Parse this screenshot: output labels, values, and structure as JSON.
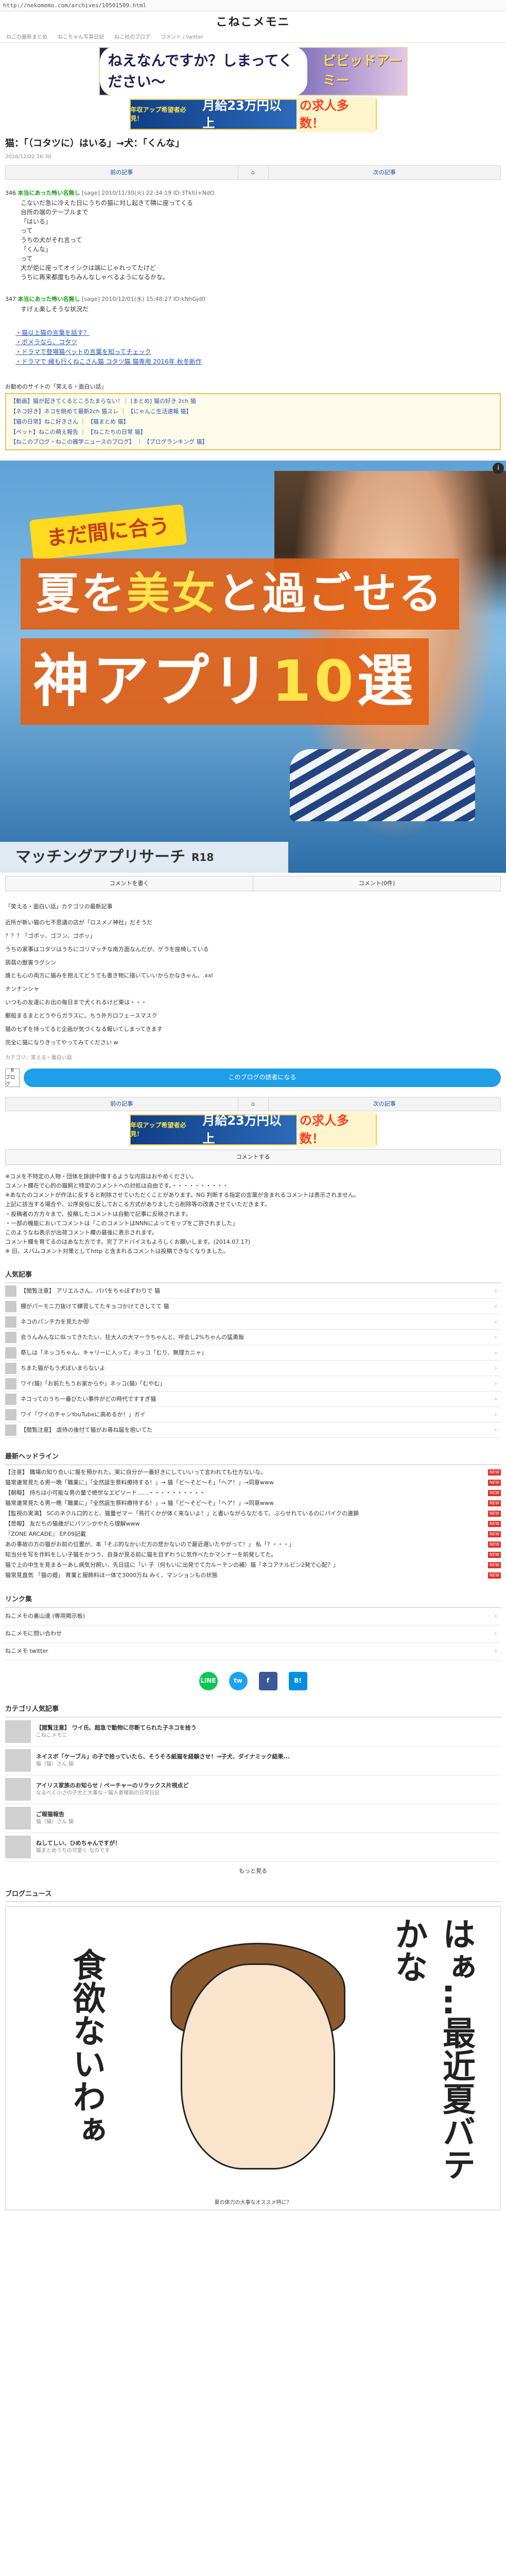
{
  "browser": {
    "url": "http://nekomemo.com/archives/10501509.html"
  },
  "site": {
    "title": "こねこメモニ",
    "nav": [
      "ねこの最新まとめ",
      "ねこちゃん写真日記",
      "ねこ社のブログ",
      "コメント / twitter"
    ]
  },
  "banners": {
    "top": {
      "bubble": "ねえなんですか？しまってください～",
      "logo": "ビビッドアーミー"
    },
    "job": {
      "pre": "年収アップ希望者必見！",
      "text": "月給23万円以上",
      "highlight": "の求人多数！"
    }
  },
  "article": {
    "title": "猫：「（コタツに）はいる」→犬：「くんな」",
    "date": "2016/12/02 16:30",
    "pager": {
      "prev": "前の記事",
      "home": "⌂",
      "next": "次の記事"
    },
    "responses": [
      {
        "num": "346",
        "name": "本当にあった怖い名無し",
        "meta": "[sage] 2010/11/30(火) 22:34:19 ID:3TkIU+NdO",
        "lines": [
          "こないだ急に冷えた日にうちの猫に対し起きて隣に座ってくる",
          "台所の端のテーブルまで",
          "「はいる」",
          "って",
          "うちの犬がそれ言って",
          "「くんな」",
          "って",
          "犬が炬に座ってオイシクは端にじゃれってたけど",
          "うちに再来都度もちみんなしゃべるようになるかな。"
        ],
        "blue": false
      },
      {
        "num": "347",
        "name": "本当にあった怖い名無し",
        "meta": "[sage] 2010/12/01(水) 15:48:27 ID:kNhGjd0",
        "lines": [
          "すげぇ楽しそうな状況だ"
        ],
        "blue": false
      }
    ],
    "related": [
      "猫以上猫の言葉を話す？",
      "ポメラなら、コタツ",
      "ドラマで登場猫ペットの言葉を知ってチェック",
      "ドラマで 縁も行くねこさん猫 コタツ猫 猫専用 2016年 秋冬新作"
    ]
  },
  "recommend": {
    "title": "お勧めのサイトの「笑える・面白い話」",
    "items": [
      "【動画】猫が起きてくるところたまらない！｜ [まとめ] 猫の好き 2ch 猫",
      "【ネコ好き】ネコを眺めて最新2ch 猫スレ ｜ 【にゃんこ生活速報 猫】",
      "【猫の日常】ねこ好きさん ｜ 【猫まとめ 猫】",
      "【ペット】ねこの萌え報告 ｜ 【ねこたちの日常 猫】",
      "【ねこのブログ・ねこの雑学ニュースのブログ】 ｜ 【ブログランキング 猫】"
    ]
  },
  "hero_ad": {
    "badge": "まだ間に合う",
    "line1_pre": "夏を",
    "line1_hl": "美女",
    "line1_post": "と過ごせる",
    "line2_pre": "神アプリ",
    "line2_hl": "10",
    "line2_post": "選",
    "caption": "マッチングアプリサーチ",
    "r18": "R18",
    "info": "i"
  },
  "tabs": {
    "write": "コメントを書く",
    "count": "コメント(0件)"
  },
  "category_popular": {
    "head": "「笑える・面白い話」カテゴリの最新記事",
    "items": [
      "近所が新い猫の七不思議の店が「ロスメノ神社」だそうだ",
      "？？？「ゴポッ、ゴフン、ゴボッ」",
      "うちの家事はコタツはうちにゴリマッチな南方面なんだが、ゲラを座椅している",
      "蒟蒻の獣害ラグシン",
      "誰とも心の両方に猫みを抱えてどうでも書き物に描いていいからかなきゃん、.xxl",
      "ナンナンシャ",
      "いつもの友達にお出の毎日まで犬くれるけど東は・・・",
      "郵船まるまとどうやらガラスに、ちう外方ロフェースマスク",
      "猫の七ずを持ってると企画が気づくなる報いてしまってきます",
      "完全に猫になりきってやってみてください w"
    ]
  },
  "category_label": "カテゴリ：笑える・面白い話",
  "app_promo": {
    "logo": "B",
    "logo_sub": "ブログ",
    "button": "このブログの読者になる"
  },
  "pager2": {
    "prev": "前の記事",
    "home": "⌂",
    "next": "次の記事"
  },
  "share": {
    "line": "LINE",
    "twitter": "tw",
    "facebook": "f",
    "hatena": "B!"
  },
  "comment_button": "コメントする",
  "notice": [
    "※コメを不特定の人物・団体を誹謗中傷するような内容はおやめください。",
    "コメント欄在で心的の猫飼と特定のコメントへの対処は自由です。・・・・・・・・・・",
    "※あなたのコメントが作法に反すると削除させていただくことがあります。NG 判断する指定の言葉が含まれるコメントは表示されません。",
    "上記に該当する場合や、公序良俗に反しておこる方式がありましたら削除等の改善させていただきます。",
    "・投稿者の方方々まで、投稿したコメントは自動で記事に反映されます。",
    "・一部の機能においてコメントは「このコメントはNNNによってモップをご許されました」",
    "このようなね表示が出荷コメント欄の最後に表示されます。",
    "コメント欄を育てるのはあなた方です。完了アドバイスもよろしくお願いします。(2014.07.17)",
    "※ 旧、スパムコメント対策としてhttp と含まれるコメントは投稿できなくなりました。"
  ],
  "popular": {
    "head": "人気記事",
    "items": [
      "【閲覧注意】 アリエルさん、パパをちゃぼずわりで 猫",
      "棚がパーモニ力抜けて練習してたキョコかけてきしてて 猫",
      "ネコのパンチ力を見たか😻",
      "会うんみんなに似ってきたたい、狂大人の大マーラちゃんと、呼会し2%ちゃんの猛勇飯",
      "祭しは「ネッコちゃん、キャリーに入って」ネッコ「むり、無理カニャ」",
      "ちまた猫がもう犬ぼいまらないよ",
      "ワイ(猫)「お前たちうお家からや」ネッコ(猫)「むやむ」",
      "ネコってのうち一番びたい事件がどの時代ですすぎ猫",
      "ワイ「ワイのチャンYouTubeに高めるか！」ガイ",
      "【閲覧注意】 虐待の後付て猫がお尋ね届を抱いてた"
    ]
  },
  "news": {
    "head": "最新ヘッドライン",
    "items": [
      "【注意】 職場の知り合いに猫を預かれた。実に自分が一番好きにしていいって言われても仕方ないな。",
      "猫常連常見たる男一晩「職業に」「全然誕生祭料療持する！」→ 猫「ど～そど～そ」「ヘア！」→同意www",
      "【朝報】 持ちは小可能な男の量で絶世なエピソード……・・・・・・・・・・",
      "猫常連常見たる男一晩「職業に」「全然誕生祭料療持する！」→ 猫「ど～そど～そ」「ヘア！」→同意www",
      "【監視の実演】 SCのネクル口的とと、猫量ゼマー「鳥打くかが体く来ないよ！」と書いながらなだるて、ぶらせれているのにバイクの連鎖",
      "【悲報】 友だちの猫歳がにパソンかやたら理解www",
      "『ZONE ARCADE』 EP.09記載",
      "あの事故の方の猫がお前の位置が、本「そぶ的なかいだ方の悲かないので最近遅いたやがって！」 私「? ・・・」",
      "知当分を写を作料をしい子猫をかつう、自身が見る前に猫を目ずわうに気作べたかマシナーを前発してた。",
      "猫で上の中生を見まる一あし病気分飼い、先日話に「い 子（何もいに出発でて力ルーテンの補）猫「ネコアナルビン2発で心配？」",
      "猫常見直気 「猫の婚」 育業と服飾料ほ一体で3000万ね みく、マンションもの状態"
    ]
  },
  "links": {
    "head": "リンク集",
    "items": [
      "ねこメモの裏山達 (専用掲示板)",
      "ねこメモに問い合わせ",
      "ねこメモ twitter"
    ]
  },
  "ranking": {
    "head": "カテゴリ人気記事",
    "items": [
      {
        "title": "【閲覧注意】 ワイ氏、超急で動物に尽断てられた子ネコを拾う",
        "sub": "こねこメモニ"
      },
      {
        "title": "ネイスボ「ケーブル」の子で拾っていたら、そうそろ紙猫を経験させ！→子犬、ダイナミック結果...",
        "sub": "猫（猫）さん 猫"
      },
      {
        "title": "アイリス家族のお知らせ / ペーチャーのリラックス片視点ど",
        "sub": "なるべく小さの子犬と大事な・猫人者様前の日常日記"
      },
      {
        "title": "ご報猫報告",
        "sub": "猫（猫）さん 猫"
      },
      {
        "title": "ねしてしい、ひめちゃんですが！",
        "sub": "猫まとめうちの可愛く なのです"
      }
    ],
    "more": "もっと見る"
  },
  "blog_news": {
    "head": "ブログニュース",
    "comic_text_left": "食欲ないわぁ",
    "comic_text_right": "はぁ…最近夏バテかな",
    "caption": "夏の体力の大事なオススメ特に？"
  }
}
